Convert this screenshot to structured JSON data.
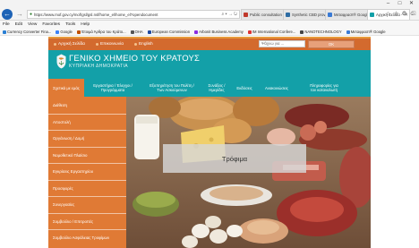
{
  "browser": {
    "url": "https://www.mof.gov.cy/mof/gsl/gsl.nsf/home_el/home_el?opendocument",
    "address_controls": "⌕ ▾ → ↻",
    "tabs": [
      {
        "label": "Public consultation ...",
        "icon_color": "#c0392b",
        "active": false
      },
      {
        "label": "Synthetic CBD prove...",
        "icon_color": "#2e6da4",
        "active": false
      },
      {
        "label": "Μεταφραστ® Google",
        "icon_color": "#3a7bd5",
        "active": false
      },
      {
        "label": "Αρχική Σελίδα - Γ...",
        "icon_color": "#13a0a8",
        "active": true
      }
    ],
    "menu": [
      "File",
      "Edit",
      "View",
      "Favorites",
      "Tools",
      "Help"
    ],
    "favorites": [
      {
        "label": "Currency Converter Fina...",
        "color": "#2a7fd4"
      },
      {
        "label": "Google",
        "color": "#3b82f6"
      },
      {
        "label": "Έτοιμά Άρθρα του Κράτο...",
        "color": "#c05000"
      },
      {
        "label": "ΟΗΑ",
        "color": "#555555"
      },
      {
        "label": "European Commission",
        "color": "#1f4aa0"
      },
      {
        "label": "Arbonit Business Academy",
        "color": "#8a2be2"
      },
      {
        "label": "IM International Confere...",
        "color": "#d33"
      },
      {
        "label": "NANOTECHNOLOGY",
        "color": "#444444"
      },
      {
        "label": "Μεταφραστ® Google",
        "color": "#3a7bd5"
      }
    ]
  },
  "topbar": {
    "links": [
      "Αρχική Σελίδα",
      "Επικοινωνία",
      "English"
    ],
    "search_placeholder": "Ψάχνω για ...",
    "search_button": "ΟΚ"
  },
  "header": {
    "title": "ΓΕΝΙΚΟ ΧΗΜΕΙΟ ΤΟΥ ΚΡΑΤΟΥΣ",
    "subtitle": "ΚΥΠΡΙΑΚΗ ΔΗΜΟΚΡΑΤΙΑ"
  },
  "nav": [
    {
      "label": "Σχετικά με εμάς",
      "width": 40,
      "active": true
    },
    {
      "label": "Εργαστήρια / Έλεγχοι /\nΠρογράμματα",
      "width": 64,
      "active": false
    },
    {
      "label": "Εξυπηρέτηση του Πολίτη /\nΤων Ασκούμενων",
      "width": 68,
      "active": false
    },
    {
      "label": "Συνάξεις /\nΗμερίδες",
      "width": 32,
      "active": false
    },
    {
      "label": "Εκδόσεις",
      "width": 30,
      "active": false
    },
    {
      "label": "Ανακοινώσεις",
      "width": 42,
      "active": false
    },
    {
      "label": "Πληροφορίες για\nτον καταναλωτή",
      "width": 64,
      "active": false
    }
  ],
  "dropdown": [
    "Διάθεση",
    "Αποστολή",
    "Οργάνωση / Δομή",
    "Νομοθετικό Πλαίσιο",
    "Εγκρίσεις Εργαστηρίου",
    "Προσφορές",
    "Συνεργασίες",
    "Συμβούλιο / Επιτροπές",
    "Συμβούλιο Ασφάλειας Τροφίμων"
  ],
  "hero": {
    "caption": "Τρόφιμα"
  },
  "colors": {
    "teal": "#13a0a8",
    "orange": "#e07a35",
    "topbar_orange": "#d36a2e"
  }
}
